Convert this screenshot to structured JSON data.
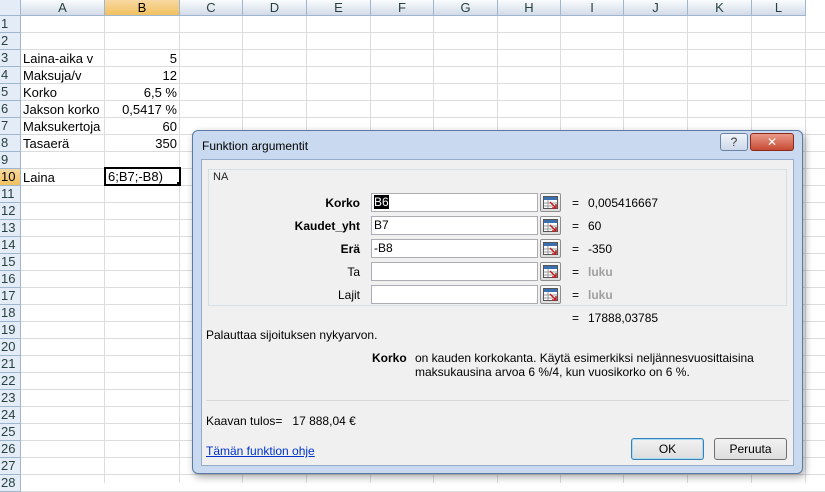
{
  "sheet": {
    "columns": [
      "A",
      "B",
      "C",
      "D",
      "E",
      "F",
      "G",
      "H",
      "I",
      "J",
      "K",
      "L"
    ],
    "rows": [
      "1",
      "2",
      "3",
      "4",
      "5",
      "6",
      "7",
      "8",
      "9",
      "10",
      "11",
      "12",
      "13",
      "14",
      "15",
      "16",
      "17",
      "18",
      "19",
      "20",
      "21",
      "22",
      "23",
      "24",
      "25",
      "26",
      "27",
      "28"
    ],
    "cells": [
      {
        "a": "",
        "b": ""
      },
      {
        "a": "",
        "b": ""
      },
      {
        "a": "Laina-aika v",
        "b": "5"
      },
      {
        "a": "Maksuja/v",
        "b": "12"
      },
      {
        "a": "Korko",
        "b": "6,5 %"
      },
      {
        "a": "Jakson korko",
        "b": "0,5417 %"
      },
      {
        "a": "Maksukertoja",
        "b": "60"
      },
      {
        "a": "Tasaerä",
        "b": "350"
      },
      {
        "a": "",
        "b": ""
      },
      {
        "a": "Laina",
        "b": "6;B7;-B8)"
      }
    ]
  },
  "dialog": {
    "title": "Funktion argumentit",
    "help_glyph": "?",
    "close_glyph": "✕",
    "function_name": "NA",
    "arguments": [
      {
        "label": "Korko",
        "value": "B6",
        "result": "0,005416667",
        "bold": true
      },
      {
        "label": "Kaudet_yht",
        "value": "B7",
        "result": "60",
        "bold": true
      },
      {
        "label": "Erä",
        "value": "-B8",
        "result": "-350",
        "bold": true
      },
      {
        "label": "Ta",
        "value": "",
        "result": "luku",
        "bold": false
      },
      {
        "label": "Lajit",
        "value": "",
        "result": "luku",
        "bold": false
      }
    ],
    "eq_sign": "=",
    "total_result": "17888,03785",
    "description": "Palauttaa sijoituksen nykyarvon.",
    "arg_desc_name": "Korko",
    "arg_desc_text": "on kauden korkokanta. Käytä esimerkiksi neljännesvuosittaisina maksukausina arvoa 6 %/4, kun vuosikorko on 6 %.",
    "formula_result_label": "Kaavan tulos=",
    "formula_result_value": "17 888,04 €",
    "help_link": "Tämän funktion ohje",
    "ok_label": "OK",
    "cancel_label": "Peruuta"
  }
}
